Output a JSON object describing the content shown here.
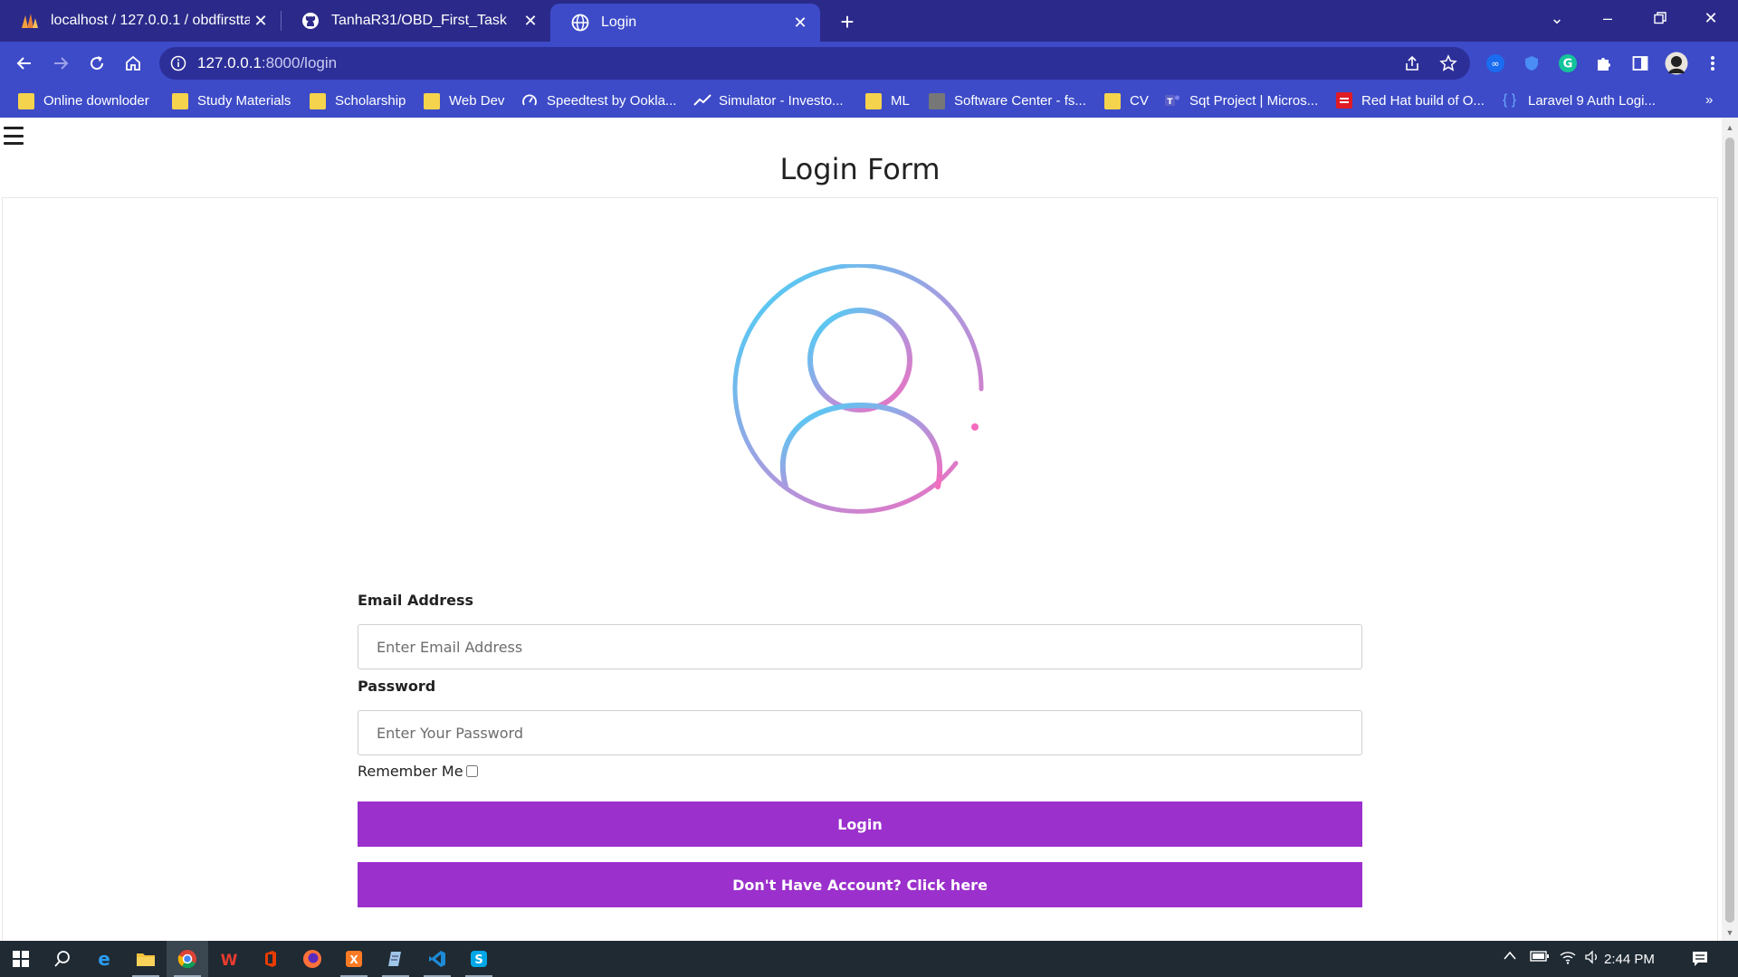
{
  "browser": {
    "tabs": [
      {
        "title": "localhost / 127.0.0.1 / obdfirsttas",
        "icon": "phpmyadmin-icon"
      },
      {
        "title": "TanhaR31/OBD_First_Task",
        "icon": "github-icon"
      },
      {
        "title": "Login",
        "icon": "globe-icon"
      }
    ],
    "address": {
      "host": "127.0.0.1",
      "path": ":8000/login"
    },
    "bookmarks": [
      {
        "label": "Online downloder",
        "icon": "folder-icon"
      },
      {
        "label": "Study Materials",
        "icon": "folder-icon"
      },
      {
        "label": "Scholarship",
        "icon": "folder-icon"
      },
      {
        "label": "Web Dev",
        "icon": "folder-icon"
      },
      {
        "label": "Speedtest by Ookla...",
        "icon": "speedtest-icon"
      },
      {
        "label": "Simulator - Investo...",
        "icon": "investopedia-icon"
      },
      {
        "label": "ML",
        "icon": "folder-icon"
      },
      {
        "label": "Software Center - fs...",
        "icon": "folder-dark-icon"
      },
      {
        "label": "CV",
        "icon": "folder-icon"
      },
      {
        "label": "Sqt Project | Micros...",
        "icon": "teams-icon"
      },
      {
        "label": "Red Hat build of O...",
        "icon": "redhat-icon"
      },
      {
        "label": "Laravel 9 Auth Logi...",
        "icon": "braces-icon"
      }
    ],
    "bookmarks_more": "»"
  },
  "page": {
    "title": "Login Form",
    "email_label": "Email Address",
    "email_placeholder": "Enter Email Address",
    "password_label": "Password",
    "password_placeholder": "Enter Your Password",
    "remember_label": "Remember Me",
    "login_button": "Login",
    "register_button": "Don't Have Account? Click here",
    "accent_color": "#9b30cc"
  },
  "taskbar": {
    "time": "2:44 PM"
  }
}
